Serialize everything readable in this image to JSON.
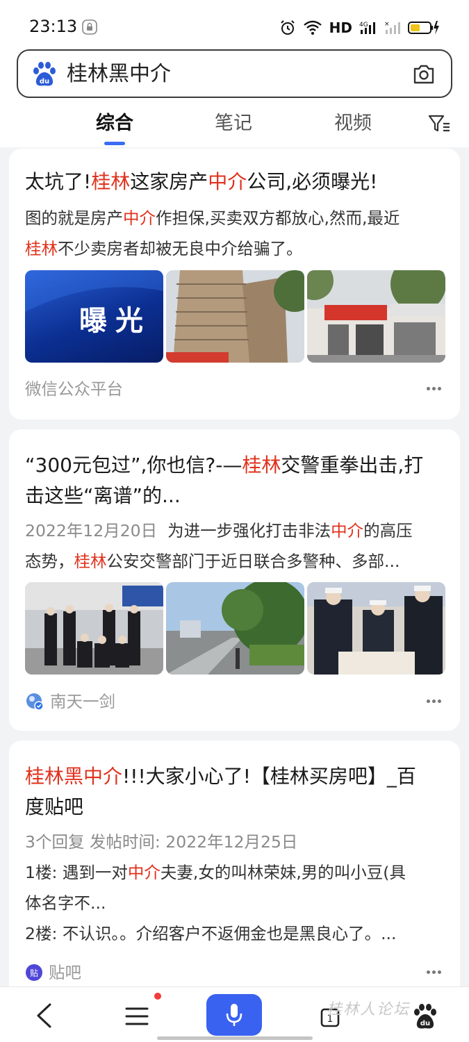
{
  "status": {
    "time": "23:13",
    "hd": "HD",
    "network": "4G"
  },
  "search": {
    "query": "桂林黑中介"
  },
  "tabs": [
    {
      "label": "综合"
    },
    {
      "label": "笔记"
    },
    {
      "label": "视频"
    }
  ],
  "results": [
    {
      "title_parts": [
        "太坑了!",
        "桂林",
        "这家房产",
        "中介",
        "公司,必须曝光!"
      ],
      "snippet_l1_parts": [
        "图的就是房产",
        "中介",
        "作担保,买卖双方都放心,然而,最近"
      ],
      "snippet_l2_parts": [
        "桂林",
        "不少卖房者却被无良中介给骗了。"
      ],
      "thumb1_text": "曝光",
      "source": "微信公众平台"
    },
    {
      "title_l1_parts": [
        "“300元包过”,你也信?-—",
        "桂林",
        "交警重拳出击,打"
      ],
      "title_l2": "击这些“离谱”的...",
      "date": "2022年12月20日",
      "snippet_l1_parts": [
        "为进一步强化打击非法",
        "中介",
        "的高压"
      ],
      "snippet_l2_parts": [
        "态势，",
        "桂林",
        "公安交警部门于近日联合多警种、多部..."
      ],
      "source": "南天一剑"
    },
    {
      "title_l1_parts": [
        "桂林黑中介",
        "!!!大家小心了!【桂林买房吧】_百"
      ],
      "title_l2": "度贴吧",
      "meta": "3个回复  发帖时间: 2022年12月25日",
      "floor1_parts": [
        "1楼: 遇到一对",
        "中介",
        "夫妻,女的叫林荣妹,男的叫小豆(具"
      ],
      "floor1_l2": "体名字不...",
      "floor2": "2楼: 不认识。。介绍客户不返佣金也是黑良心了。...",
      "source": "贴吧"
    }
  ],
  "watermark": "桂林人论坛",
  "colors": {
    "accent": "#3a62f0",
    "highlight": "#e0321d",
    "background": "#f2f3f5"
  }
}
